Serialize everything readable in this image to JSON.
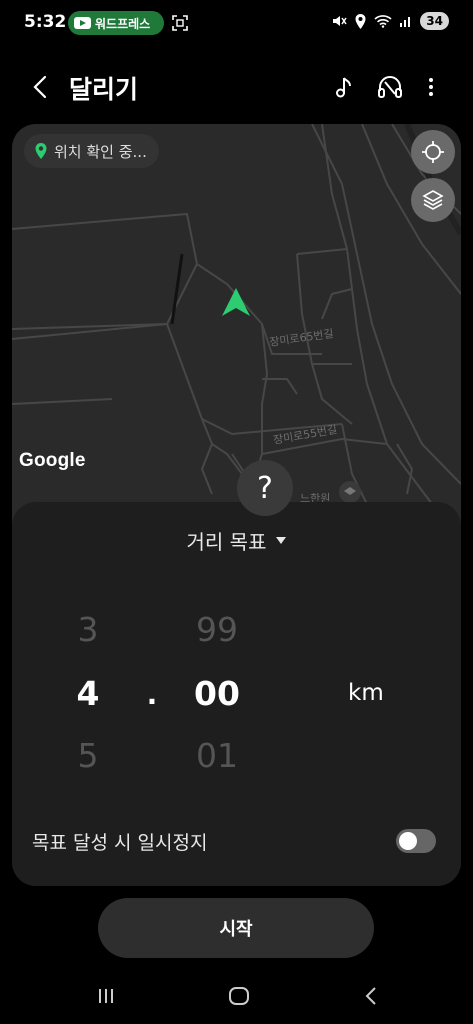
{
  "status_bar": {
    "time": "5:32",
    "notification_app": "워드프레스",
    "battery_level": "34",
    "icons": [
      "youtube-icon",
      "screenshot-scan-icon",
      "mute-icon",
      "location-icon",
      "wifi-icon",
      "signal-icon"
    ]
  },
  "app_bar": {
    "title": "달리기",
    "icons": [
      "back-icon",
      "music-icon",
      "headphones-icon",
      "more-vert-icon"
    ]
  },
  "map": {
    "location_status": "위치 확인 중...",
    "provider_logo": "Google",
    "street_labels": [
      "장미로65번길",
      "장미로55번길",
      "느한원"
    ],
    "colors": {
      "background": "#2a2a2a",
      "roads": "#4a4a4a",
      "user_arrow": "#2ecc71"
    }
  },
  "help_button": {
    "label": "?"
  },
  "goal_sheet": {
    "goal_type": "거리 목표",
    "integer_picker": {
      "previous": "3",
      "selected": "4",
      "next": "5"
    },
    "separator": ".",
    "decimal_picker": {
      "previous": "99",
      "selected": "00",
      "next": "01"
    },
    "unit": "km",
    "pause_on_goal_label": "목표 달성 시 일시정지",
    "pause_on_goal_enabled": false
  },
  "start_button": {
    "label": "시작"
  },
  "nav_bar": {
    "icons": [
      "recent-apps-icon",
      "home-icon",
      "back-nav-icon"
    ]
  },
  "theme": {
    "accent": "#2ecc71",
    "sheet_bg": "#1e1e1e",
    "button_bg": "#2e2e2e"
  }
}
